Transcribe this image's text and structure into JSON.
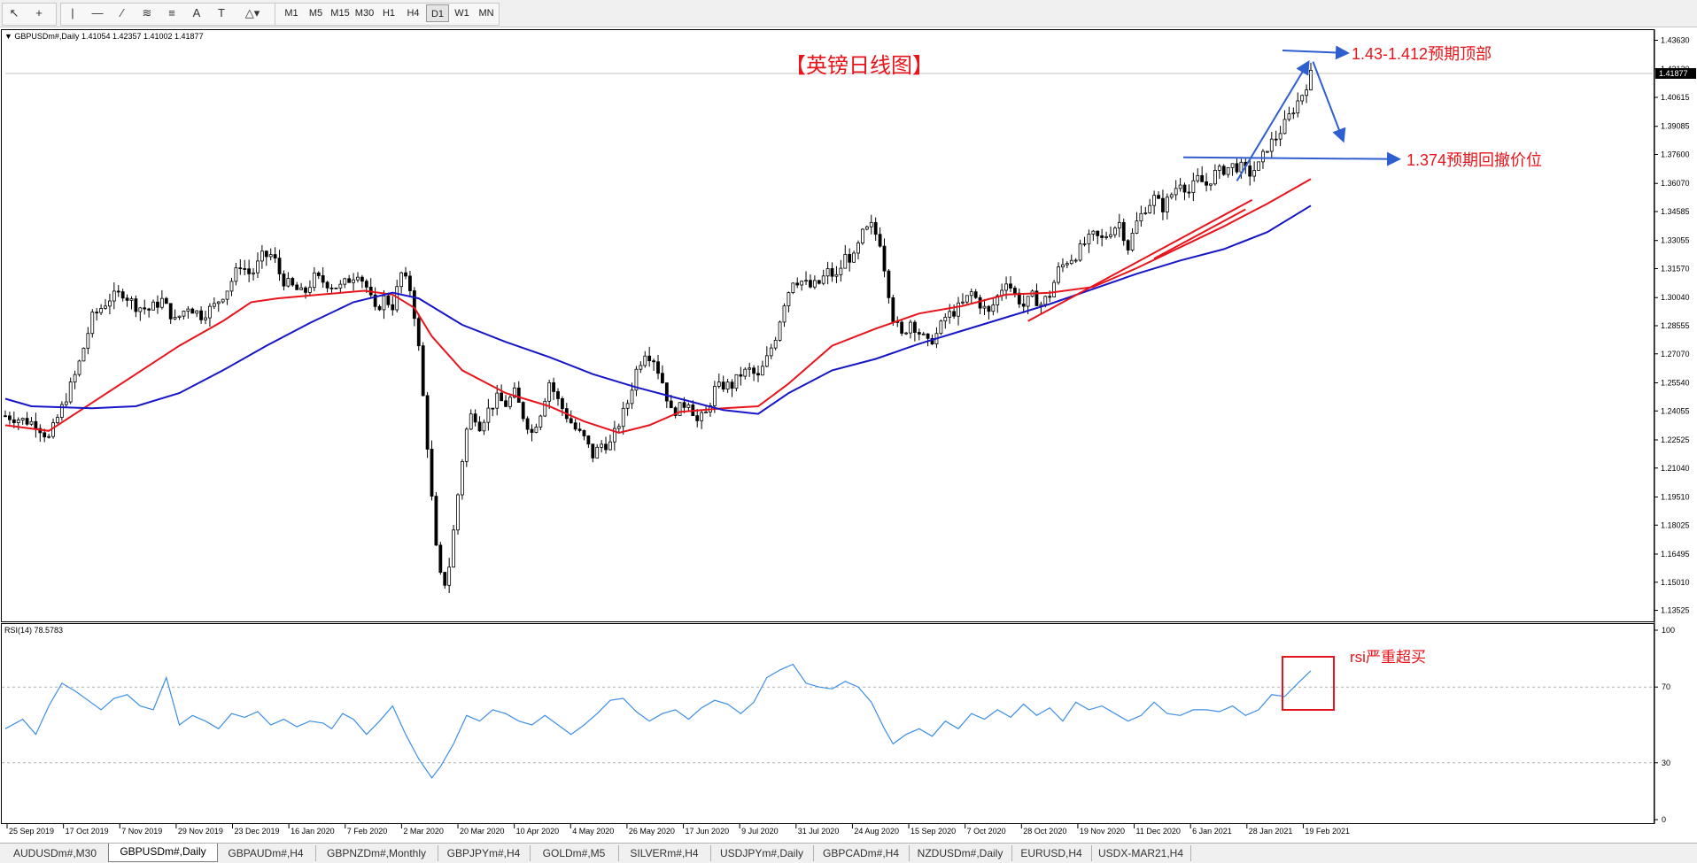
{
  "toolbar": {
    "timeframes": [
      "M1",
      "M5",
      "M15",
      "M30",
      "H1",
      "H4",
      "D1",
      "W1",
      "MN"
    ],
    "active_timeframe": "D1",
    "icons": [
      "cursor-icon",
      "crosshair-icon",
      "vertical-line-icon",
      "horizontal-line-icon",
      "trendline-icon",
      "channel-icon",
      "fibonacci-icon",
      "text-icon",
      "text-label-icon",
      "shapes-icon"
    ]
  },
  "main_chart": {
    "header": "GBPUSDm#,Daily  1.41054 1.42357 1.41002 1.41877",
    "annotation_title": "【英镑日线图】",
    "annotation_top": "1.43-1.412预期顶部",
    "annotation_pullback": "1.374预期回撤价位",
    "current_price_label": "1.41877",
    "price_ticks": [
      "1.43630",
      "1.42120",
      "1.40615",
      "1.39085",
      "1.37600",
      "1.36070",
      "1.34585",
      "1.33055",
      "1.31570",
      "1.30040",
      "1.28555",
      "1.27070",
      "1.25540",
      "1.24055",
      "1.22525",
      "1.21040",
      "1.19510",
      "1.18025",
      "1.16495",
      "1.15010",
      "1.13525"
    ]
  },
  "rsi_panel": {
    "header": "RSI(14) 78.5783",
    "annotation": "rsi严重超买",
    "ticks": [
      "100",
      "70",
      "30",
      "0"
    ]
  },
  "date_labels": [
    "25 Sep 2019",
    "17 Oct 2019",
    "7 Nov 2019",
    "29 Nov 2019",
    "23 Dec 2019",
    "16 Jan 2020",
    "7 Feb 2020",
    "2 Mar 2020",
    "20 Mar 2020",
    "10 Apr 2020",
    "4 May 2020",
    "26 May 2020",
    "17 Jun 2020",
    "9 Jul 2020",
    "31 Jul 2020",
    "24 Aug 2020",
    "15 Sep 2020",
    "7 Oct 2020",
    "28 Oct 2020",
    "19 Nov 2020",
    "11 Dec 2020",
    "6 Jan 2021",
    "28 Jan 2021",
    "19 Feb 2021"
  ],
  "tabs": [
    {
      "label": "AUDUSDm#,M30",
      "active": false
    },
    {
      "label": "GBPUSDm#,Daily",
      "active": true
    },
    {
      "label": "GBPAUDm#,H4",
      "active": false
    },
    {
      "label": "GBPNZDm#,Monthly",
      "active": false
    },
    {
      "label": "GBPJPYm#,H4",
      "active": false
    },
    {
      "label": "GOLDm#,M5",
      "active": false
    },
    {
      "label": "SILVERm#,H4",
      "active": false
    },
    {
      "label": "USDJPYm#,Daily",
      "active": false
    },
    {
      "label": "GBPCADm#,H4",
      "active": false
    },
    {
      "label": "NZDUSDm#,Daily",
      "active": false
    },
    {
      "label": "EURUSD,H4",
      "active": false
    },
    {
      "label": "USDX-MAR21,H4",
      "active": false
    }
  ],
  "colors": {
    "candle": "#000000",
    "ma_fast": "#e8141b",
    "ma_slow": "#1616c8",
    "rsi_line": "#3c8ee6",
    "annotation_red": "#e8141b",
    "annotation_blue": "#2f5fcf",
    "trend_red": "#e8141b",
    "pullback_line": "#2f5fcf",
    "rsi_box": "#e8141b"
  },
  "chart_data": {
    "type": "candlestick",
    "symbol": "GBPUSDm#",
    "timeframe": "Daily",
    "ohlc_last": {
      "open": 1.41054,
      "high": 1.42357,
      "low": 1.41002,
      "close": 1.41877
    },
    "ylim": [
      1.1313,
      1.4398
    ],
    "close_path": [
      [
        0,
        1.238
      ],
      [
        14,
        1.234
      ],
      [
        20,
        1.226
      ],
      [
        27,
        1.245
      ],
      [
        33,
        1.262
      ],
      [
        40,
        1.29
      ],
      [
        48,
        1.3
      ],
      [
        54,
        1.303
      ],
      [
        60,
        1.296
      ],
      [
        66,
        1.294
      ],
      [
        72,
        1.299
      ],
      [
        78,
        1.288
      ],
      [
        84,
        1.296
      ],
      [
        90,
        1.291
      ],
      [
        96,
        1.296
      ],
      [
        102,
        1.305
      ],
      [
        108,
        1.318
      ],
      [
        113,
        1.312
      ],
      [
        118,
        1.322
      ],
      [
        123,
        1.323
      ],
      [
        127,
        1.31
      ],
      [
        132,
        1.306
      ],
      [
        137,
        1.302
      ],
      [
        142,
        1.311
      ],
      [
        146,
        1.309
      ],
      [
        150,
        1.307
      ],
      [
        154,
        1.306
      ],
      [
        158,
        1.31
      ],
      [
        162,
        1.314
      ],
      [
        166,
        1.306
      ],
      [
        170,
        1.293
      ],
      [
        174,
        1.3
      ],
      [
        178,
        1.296
      ],
      [
        182,
        1.313
      ],
      [
        186,
        1.305
      ],
      [
        189,
        1.285
      ],
      [
        191,
        1.262
      ],
      [
        193,
        1.234
      ],
      [
        195,
        1.211
      ],
      [
        197,
        1.177
      ],
      [
        199,
        1.158
      ],
      [
        201,
        1.148
      ],
      [
        203,
        1.152
      ],
      [
        205,
        1.166
      ],
      [
        207,
        1.188
      ],
      [
        209,
        1.205
      ],
      [
        211,
        1.225
      ],
      [
        213,
        1.236
      ],
      [
        215,
        1.24
      ],
      [
        218,
        1.233
      ],
      [
        222,
        1.241
      ],
      [
        226,
        1.247
      ],
      [
        230,
        1.244
      ],
      [
        234,
        1.25
      ],
      [
        238,
        1.238
      ],
      [
        242,
        1.229
      ],
      [
        246,
        1.24
      ],
      [
        250,
        1.256
      ],
      [
        254,
        1.246
      ],
      [
        258,
        1.238
      ],
      [
        262,
        1.231
      ],
      [
        266,
        1.226
      ],
      [
        270,
        1.217
      ],
      [
        274,
        1.223
      ],
      [
        278,
        1.223
      ],
      [
        282,
        1.234
      ],
      [
        286,
        1.245
      ],
      [
        290,
        1.262
      ],
      [
        294,
        1.272
      ],
      [
        298,
        1.268
      ],
      [
        302,
        1.256
      ],
      [
        306,
        1.24
      ],
      [
        310,
        1.242
      ],
      [
        314,
        1.246
      ],
      [
        318,
        1.235
      ],
      [
        322,
        1.239
      ],
      [
        326,
        1.252
      ],
      [
        330,
        1.254
      ],
      [
        334,
        1.254
      ],
      [
        338,
        1.26
      ],
      [
        342,
        1.262
      ],
      [
        346,
        1.258
      ],
      [
        350,
        1.268
      ],
      [
        354,
        1.28
      ],
      [
        358,
        1.298
      ],
      [
        362,
        1.31
      ],
      [
        366,
        1.309
      ],
      [
        370,
        1.306
      ],
      [
        374,
        1.308
      ],
      [
        378,
        1.314
      ],
      [
        382,
        1.311
      ],
      [
        386,
        1.322
      ],
      [
        390,
        1.321
      ],
      [
        394,
        1.334
      ],
      [
        398,
        1.338
      ],
      [
        402,
        1.33
      ],
      [
        405,
        1.31
      ],
      [
        408,
        1.29
      ],
      [
        412,
        1.28
      ],
      [
        416,
        1.288
      ],
      [
        420,
        1.282
      ],
      [
        424,
        1.276
      ],
      [
        428,
        1.281
      ],
      [
        432,
        1.29
      ],
      [
        436,
        1.293
      ],
      [
        440,
        1.297
      ],
      [
        444,
        1.303
      ],
      [
        448,
        1.297
      ],
      [
        452,
        1.292
      ],
      [
        456,
        1.301
      ],
      [
        460,
        1.31
      ],
      [
        464,
        1.302
      ],
      [
        468,
        1.296
      ],
      [
        472,
        1.301
      ],
      [
        476,
        1.297
      ],
      [
        480,
        1.302
      ],
      [
        484,
        1.315
      ],
      [
        488,
        1.32
      ],
      [
        492,
        1.323
      ],
      [
        496,
        1.329
      ],
      [
        500,
        1.333
      ],
      [
        504,
        1.331
      ],
      [
        508,
        1.336
      ],
      [
        512,
        1.34
      ],
      [
        516,
        1.327
      ],
      [
        520,
        1.34
      ],
      [
        524,
        1.348
      ],
      [
        528,
        1.353
      ],
      [
        532,
        1.348
      ],
      [
        536,
        1.355
      ],
      [
        540,
        1.362
      ],
      [
        544,
        1.356
      ],
      [
        548,
        1.363
      ],
      [
        552,
        1.36
      ],
      [
        556,
        1.366
      ],
      [
        560,
        1.368
      ],
      [
        564,
        1.37
      ],
      [
        568,
        1.369
      ],
      [
        572,
        1.366
      ],
      [
        576,
        1.37
      ],
      [
        580,
        1.38
      ],
      [
        584,
        1.385
      ],
      [
        588,
        1.392
      ],
      [
        592,
        1.4
      ],
      [
        596,
        1.408
      ],
      [
        600,
        1.418
      ]
    ],
    "ma_fast_path": [
      [
        0,
        1.233
      ],
      [
        20,
        1.23
      ],
      [
        40,
        1.245
      ],
      [
        60,
        1.26
      ],
      [
        80,
        1.275
      ],
      [
        100,
        1.288
      ],
      [
        113,
        1.298
      ],
      [
        125,
        1.3
      ],
      [
        145,
        1.302
      ],
      [
        165,
        1.304
      ],
      [
        178,
        1.302
      ],
      [
        188,
        1.295
      ],
      [
        196,
        1.28
      ],
      [
        210,
        1.262
      ],
      [
        230,
        1.25
      ],
      [
        250,
        1.243
      ],
      [
        266,
        1.235
      ],
      [
        282,
        1.229
      ],
      [
        296,
        1.233
      ],
      [
        310,
        1.24
      ],
      [
        330,
        1.242
      ],
      [
        346,
        1.243
      ],
      [
        360,
        1.255
      ],
      [
        380,
        1.275
      ],
      [
        400,
        1.284
      ],
      [
        420,
        1.292
      ],
      [
        440,
        1.296
      ],
      [
        460,
        1.302
      ],
      [
        480,
        1.303
      ],
      [
        500,
        1.306
      ],
      [
        520,
        1.316
      ],
      [
        540,
        1.327
      ],
      [
        560,
        1.338
      ],
      [
        580,
        1.35
      ],
      [
        600,
        1.363
      ]
    ],
    "ma_slow_path": [
      [
        0,
        1.247
      ],
      [
        12,
        1.243
      ],
      [
        40,
        1.242
      ],
      [
        60,
        1.243
      ],
      [
        80,
        1.25
      ],
      [
        100,
        1.262
      ],
      [
        120,
        1.275
      ],
      [
        140,
        1.287
      ],
      [
        160,
        1.298
      ],
      [
        178,
        1.303
      ],
      [
        190,
        1.3
      ],
      [
        210,
        1.286
      ],
      [
        230,
        1.277
      ],
      [
        250,
        1.269
      ],
      [
        270,
        1.26
      ],
      [
        290,
        1.253
      ],
      [
        310,
        1.247
      ],
      [
        330,
        1.241
      ],
      [
        346,
        1.239
      ],
      [
        360,
        1.25
      ],
      [
        380,
        1.262
      ],
      [
        400,
        1.268
      ],
      [
        420,
        1.276
      ],
      [
        440,
        1.283
      ],
      [
        460,
        1.29
      ],
      [
        480,
        1.297
      ],
      [
        500,
        1.305
      ],
      [
        520,
        1.313
      ],
      [
        540,
        1.32
      ],
      [
        560,
        1.326
      ],
      [
        580,
        1.335
      ],
      [
        600,
        1.349
      ]
    ],
    "annotation_levels": {
      "top_zone": 1.43,
      "pullback": 1.374
    },
    "rsi": {
      "period": 14,
      "last": 78.5783,
      "ylim": [
        0,
        100
      ],
      "levels": [
        70,
        30
      ],
      "path": [
        [
          0,
          48
        ],
        [
          8,
          53
        ],
        [
          14,
          45
        ],
        [
          20,
          60
        ],
        [
          26,
          72
        ],
        [
          32,
          68
        ],
        [
          38,
          63
        ],
        [
          44,
          58
        ],
        [
          50,
          64
        ],
        [
          56,
          66
        ],
        [
          62,
          60
        ],
        [
          68,
          58
        ],
        [
          74,
          75
        ],
        [
          80,
          50
        ],
        [
          86,
          55
        ],
        [
          92,
          52
        ],
        [
          98,
          48
        ],
        [
          104,
          56
        ],
        [
          110,
          54
        ],
        [
          116,
          57
        ],
        [
          122,
          50
        ],
        [
          128,
          53
        ],
        [
          134,
          49
        ],
        [
          140,
          52
        ],
        [
          146,
          51
        ],
        [
          150,
          48
        ],
        [
          155,
          56
        ],
        [
          160,
          53
        ],
        [
          166,
          45
        ],
        [
          172,
          52
        ],
        [
          178,
          60
        ],
        [
          184,
          45
        ],
        [
          190,
          32
        ],
        [
          196,
          22
        ],
        [
          200,
          28
        ],
        [
          206,
          40
        ],
        [
          212,
          55
        ],
        [
          218,
          52
        ],
        [
          224,
          58
        ],
        [
          230,
          56
        ],
        [
          236,
          52
        ],
        [
          242,
          50
        ],
        [
          248,
          55
        ],
        [
          254,
          50
        ],
        [
          260,
          45
        ],
        [
          266,
          50
        ],
        [
          272,
          56
        ],
        [
          278,
          63
        ],
        [
          284,
          64
        ],
        [
          290,
          57
        ],
        [
          296,
          52
        ],
        [
          302,
          56
        ],
        [
          308,
          58
        ],
        [
          314,
          53
        ],
        [
          320,
          59
        ],
        [
          326,
          63
        ],
        [
          332,
          61
        ],
        [
          338,
          56
        ],
        [
          344,
          62
        ],
        [
          350,
          75
        ],
        [
          356,
          79
        ],
        [
          362,
          82
        ],
        [
          368,
          72
        ],
        [
          374,
          70
        ],
        [
          380,
          69
        ],
        [
          386,
          73
        ],
        [
          392,
          70
        ],
        [
          398,
          62
        ],
        [
          404,
          48
        ],
        [
          408,
          40
        ],
        [
          414,
          45
        ],
        [
          420,
          48
        ],
        [
          426,
          44
        ],
        [
          432,
          52
        ],
        [
          438,
          48
        ],
        [
          444,
          56
        ],
        [
          450,
          53
        ],
        [
          456,
          58
        ],
        [
          462,
          54
        ],
        [
          468,
          61
        ],
        [
          474,
          55
        ],
        [
          480,
          59
        ],
        [
          486,
          52
        ],
        [
          492,
          62
        ],
        [
          498,
          58
        ],
        [
          504,
          60
        ],
        [
          510,
          56
        ],
        [
          516,
          52
        ],
        [
          522,
          55
        ],
        [
          528,
          62
        ],
        [
          534,
          56
        ],
        [
          540,
          55
        ],
        [
          546,
          58
        ],
        [
          552,
          58
        ],
        [
          558,
          57
        ],
        [
          564,
          60
        ],
        [
          570,
          55
        ],
        [
          576,
          58
        ],
        [
          582,
          66
        ],
        [
          588,
          65
        ],
        [
          594,
          72
        ],
        [
          600,
          78.6
        ]
      ]
    }
  }
}
